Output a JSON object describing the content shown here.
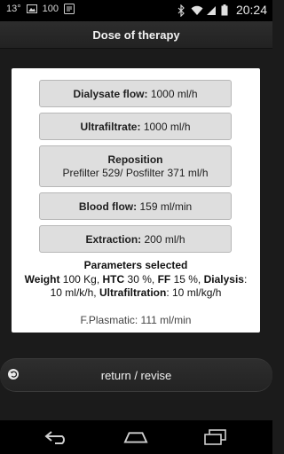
{
  "status_bar": {
    "temperature": "13°",
    "battery_text": "100",
    "time": "20:24"
  },
  "title": "Dose of therapy",
  "items": {
    "dialysate": {
      "label": "Dialysate flow:",
      "value": "1000 ml/h"
    },
    "ultrafiltrate": {
      "label": "Ultrafiltrate:",
      "value": "1000 ml/h"
    },
    "reposition": {
      "label": "Reposition",
      "value": "Prefilter 529/ Posfilter 371 ml/h"
    },
    "blood_flow": {
      "label": "Blood flow:",
      "value": "159 ml/min"
    },
    "extraction": {
      "label": "Extraction:",
      "value": "200 ml/h"
    }
  },
  "parameters": {
    "title": "Parameters selected",
    "weight_label": "Weight",
    "weight_value": "100 Kg,",
    "htc_label": "HTC",
    "htc_value": "30 %,",
    "ff_label": "FF",
    "ff_value": "15 %,",
    "dialysis_label": "Dialysis",
    "dialysis_colon": ":",
    "dialysis_value": "10 ml/k/h,",
    "ultrafiltration_label": "Ultrafiltration",
    "ultrafiltration_value": ": 10 ml/kg/h"
  },
  "plasmatic": "F.Plasmatic: 111 ml/min",
  "return_button": "return / revise"
}
